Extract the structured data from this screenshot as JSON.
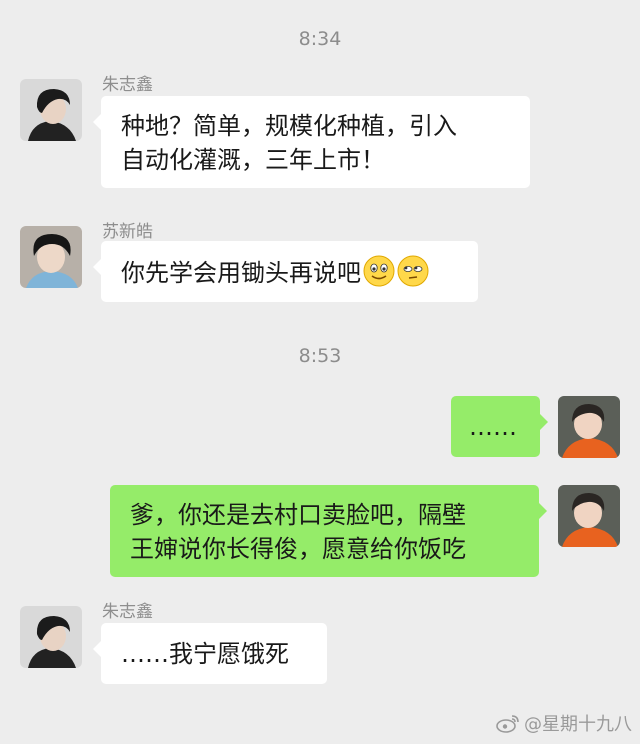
{
  "timestamps": [
    "8:34",
    "8:53"
  ],
  "messages": [
    {
      "sender": "朱志鑫",
      "line1": "种地？简单，规模化种植，引入",
      "line2": "自动化灌溉，三年上市！"
    },
    {
      "sender": "苏新皓",
      "text": "你先学会用锄头再说吧",
      "emojis": [
        "smile-emoji",
        "eye-roll-emoji"
      ]
    },
    {
      "text": "……"
    },
    {
      "line1": "爹，你还是去村口卖脸吧，隔壁",
      "line2": "王婶说你长得俊，愿意给你饭吃"
    },
    {
      "sender": "朱志鑫",
      "text": "……我宁愿饿死"
    }
  ],
  "watermark": "@星期十九八",
  "colors": {
    "background": "#ededed",
    "incoming_bubble": "#ffffff",
    "outgoing_bubble": "#95ec69",
    "text": "#191919",
    "meta_text": "#8c8c8c"
  }
}
